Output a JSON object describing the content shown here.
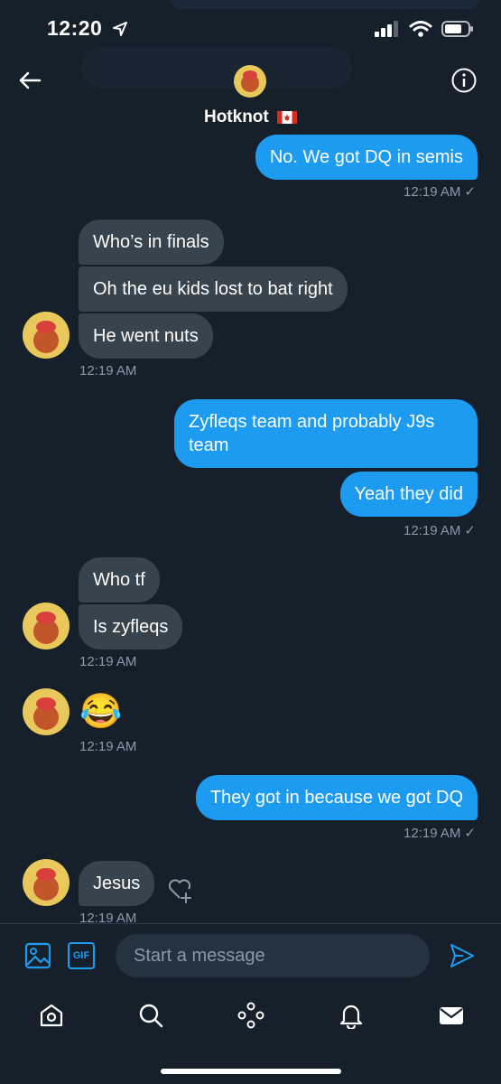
{
  "status_bar": {
    "time": "12:20"
  },
  "header": {
    "contact_name": "Hotknot",
    "flag": "canada-flag",
    "back_icon": "arrow-left-icon",
    "info_icon": "info-icon"
  },
  "messages": [
    {
      "side": "out",
      "text": "No. We got DQ in semis"
    },
    {
      "side": "out_ts",
      "text": "12:19 AM"
    },
    {
      "side": "in",
      "text": "Who’s in finals"
    },
    {
      "side": "in",
      "text": "Oh the eu kids lost to bat right"
    },
    {
      "side": "in",
      "text": "He went nuts"
    },
    {
      "side": "in_ts",
      "text": "12:19 AM"
    },
    {
      "side": "out",
      "text": "Zyfleqs team and probably J9s team"
    },
    {
      "side": "out",
      "text": "Yeah they did"
    },
    {
      "side": "out_ts",
      "text": "12:19 AM"
    },
    {
      "side": "in",
      "text": "Who tf"
    },
    {
      "side": "in",
      "text": "Is zyfleqs"
    },
    {
      "side": "in_ts",
      "text": "12:19 AM"
    },
    {
      "side": "in_emoji",
      "text": "😂"
    },
    {
      "side": "in_ts",
      "text": "12:19 AM"
    },
    {
      "side": "out",
      "text": "They got in because we got DQ"
    },
    {
      "side": "out_ts",
      "text": "12:19 AM"
    },
    {
      "side": "in",
      "text": "Jesus"
    },
    {
      "side": "in_ts",
      "text": "12:19 AM"
    }
  ],
  "compose": {
    "placeholder": "Start a message",
    "gif_label": "GIF"
  },
  "bottom_nav": [
    "home-icon",
    "search-icon",
    "spaces-icon",
    "notifications-icon",
    "messages-icon"
  ],
  "colors": {
    "background": "#15202b",
    "outgoing": "#1d9bf0",
    "incoming": "#38444d",
    "timestamp": "#8b98a5"
  }
}
